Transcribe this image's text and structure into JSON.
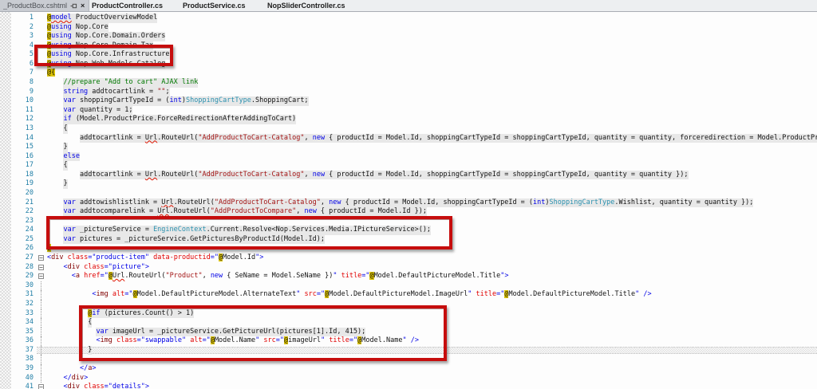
{
  "tab_bar": {
    "active_tab": {
      "label": "_ProductBox.cshtml",
      "pin_icon": "pin-icon",
      "close_icon": "×"
    },
    "tabs": [
      "ProductController.cs",
      "ProductService.cs",
      "NopSliderController.cs"
    ]
  },
  "colors": {
    "annotation_red": "#c60d0d",
    "razor_delimiter_bg": "#dcc404",
    "razor_code_bg": "#e8e8e8",
    "keyword_blue": "#0000e6",
    "type_teal": "#2b91af",
    "string_red": "#a31515",
    "comment_green": "#007800",
    "html_tag_maroon": "#800000",
    "attr_name_red": "#e00000",
    "line_number_teal": "#1f7ea6"
  },
  "annotations": {
    "highlight_boxes": [
      {
        "name": "box-using-infrastructure",
        "lines": "5"
      },
      {
        "name": "box-picture-service",
        "lines": "24-25"
      },
      {
        "name": "box-swappable-image",
        "lines": "33-37"
      }
    ],
    "selection_band_line": 37
  },
  "editor": {
    "lines": [
      {
        "n": 1,
        "rz": 1,
        "segs": [
          [
            "at",
            "@"
          ],
          [
            "k sq",
            "model"
          ],
          [
            "p",
            " ProductOverviewModel"
          ]
        ]
      },
      {
        "n": 2,
        "rz": 1,
        "segs": [
          [
            "at",
            "@"
          ],
          [
            "k",
            "using"
          ],
          [
            "p",
            " Nop.Core"
          ]
        ]
      },
      {
        "n": 3,
        "rz": 1,
        "segs": [
          [
            "at",
            "@"
          ],
          [
            "k",
            "using"
          ],
          [
            "p",
            " Nop.Core.Domain.Orders"
          ]
        ]
      },
      {
        "n": 4,
        "rz": 1,
        "segs": [
          [
            "at",
            "@"
          ],
          [
            "k",
            "using"
          ],
          [
            "p",
            " Nop.Core.Domain.Tax"
          ]
        ]
      },
      {
        "n": 5,
        "rz": 1,
        "segs": [
          [
            "at",
            "@"
          ],
          [
            "k",
            "using"
          ],
          [
            "p",
            " Nop.Core.Infrastructure"
          ]
        ]
      },
      {
        "n": 6,
        "rz": 1,
        "segs": [
          [
            "at",
            "@"
          ],
          [
            "k",
            "using"
          ],
          [
            "p",
            " Nop.Web.Models.Catalog"
          ]
        ]
      },
      {
        "n": 7,
        "segs": [
          [
            "at",
            "@{"
          ]
        ]
      },
      {
        "n": 8,
        "ind": 4,
        "rz": 1,
        "segs": [
          [
            "c",
            "//prepare \"Add to cart\" AJAX link"
          ]
        ]
      },
      {
        "n": 9,
        "ind": 4,
        "rz": 1,
        "segs": [
          [
            "k",
            "string"
          ],
          [
            "p",
            " addtocartlink = "
          ],
          [
            "s",
            "\"\""
          ],
          [
            "p",
            ";"
          ]
        ]
      },
      {
        "n": 10,
        "ind": 4,
        "rz": 1,
        "segs": [
          [
            "k",
            "var"
          ],
          [
            "p",
            " shoppingCartTypeId = ("
          ],
          [
            "k",
            "int"
          ],
          [
            "p",
            ")"
          ],
          [
            "t",
            "ShoppingCartType"
          ],
          [
            "p",
            ".ShoppingCart;"
          ]
        ]
      },
      {
        "n": 11,
        "ind": 4,
        "rz": 1,
        "segs": [
          [
            "k",
            "var"
          ],
          [
            "p",
            " quantity = 1;"
          ]
        ]
      },
      {
        "n": 12,
        "ind": 4,
        "rz": 1,
        "segs": [
          [
            "k",
            "if"
          ],
          [
            "p",
            " (Model.ProductPrice.ForceRedirectionAfterAddingToCart)"
          ]
        ]
      },
      {
        "n": 13,
        "ind": 4,
        "rz": 1,
        "segs": [
          [
            "p",
            "{"
          ]
        ]
      },
      {
        "n": 14,
        "ind": 8,
        "rz": 1,
        "segs": [
          [
            "p",
            "addtocartlink = "
          ],
          [
            "p sq",
            "Url"
          ],
          [
            "p",
            ".RouteUrl("
          ],
          [
            "s",
            "\"AddProductToCart-Catalog\""
          ],
          [
            "p",
            ", "
          ],
          [
            "k",
            "new"
          ],
          [
            "p",
            " { productId = Model.Id, shoppingCartTypeId = shoppingCartTypeId, quantity = quantity, forceredirection = Model.ProductPrice.ForceRedirectionAfterAddingToCart });"
          ]
        ]
      },
      {
        "n": 15,
        "ind": 4,
        "rz": 1,
        "segs": [
          [
            "p",
            "}"
          ]
        ]
      },
      {
        "n": 16,
        "ind": 4,
        "rz": 1,
        "segs": [
          [
            "k",
            "else"
          ]
        ]
      },
      {
        "n": 17,
        "ind": 4,
        "rz": 1,
        "segs": [
          [
            "p",
            "{"
          ]
        ]
      },
      {
        "n": 18,
        "ind": 8,
        "rz": 1,
        "segs": [
          [
            "p",
            "addtocartlink = "
          ],
          [
            "p sq",
            "Url"
          ],
          [
            "p",
            ".RouteUrl("
          ],
          [
            "s",
            "\"AddProductToCart-Catalog\""
          ],
          [
            "p",
            ", "
          ],
          [
            "k",
            "new"
          ],
          [
            "p",
            " { productId = Model.Id, shoppingCartTypeId = shoppingCartTypeId, quantity = quantity });"
          ]
        ]
      },
      {
        "n": 19,
        "ind": 4,
        "rz": 1,
        "segs": [
          [
            "p",
            "}"
          ]
        ]
      },
      {
        "n": 20,
        "rz": 1,
        "segs": []
      },
      {
        "n": 21,
        "ind": 4,
        "rz": 1,
        "segs": [
          [
            "k",
            "var"
          ],
          [
            "p",
            " addtowishlistlink = "
          ],
          [
            "p sq",
            "Url"
          ],
          [
            "p",
            ".RouteUrl("
          ],
          [
            "s",
            "\"AddProductToCart-Catalog\""
          ],
          [
            "p",
            ", "
          ],
          [
            "k",
            "new"
          ],
          [
            "p",
            " { productId = Model.Id, shoppingCartTypeId = ("
          ],
          [
            "k",
            "int"
          ],
          [
            "p",
            ")"
          ],
          [
            "t",
            "ShoppingCartType"
          ],
          [
            "p",
            ".Wishlist, quantity = quantity });"
          ]
        ]
      },
      {
        "n": 22,
        "ind": 4,
        "rz": 1,
        "segs": [
          [
            "k",
            "var"
          ],
          [
            "p",
            " addtocomparelink = "
          ],
          [
            "p sq",
            "Url"
          ],
          [
            "p",
            ".RouteUrl("
          ],
          [
            "s",
            "\"AddProductToCompare\""
          ],
          [
            "p",
            ", "
          ],
          [
            "k",
            "new"
          ],
          [
            "p",
            " { productId = Model.Id });"
          ]
        ]
      },
      {
        "n": 23,
        "rz": 1,
        "segs": []
      },
      {
        "n": 24,
        "ind": 4,
        "rz": 1,
        "segs": [
          [
            "k",
            "var"
          ],
          [
            "p",
            " _pictureService = "
          ],
          [
            "t",
            "EngineContext"
          ],
          [
            "p",
            ".Current.Resolve<Nop.Services.Media.IPictureService>();"
          ]
        ]
      },
      {
        "n": 25,
        "ind": 4,
        "rz": 1,
        "segs": [
          [
            "k",
            "var"
          ],
          [
            "p",
            " pictures = _pictureService.GetPicturesByProductId(Model.Id);"
          ]
        ]
      },
      {
        "n": 26,
        "segs": [
          [
            "at",
            "}"
          ]
        ]
      },
      {
        "n": 27,
        "fold": "box",
        "segs": [
          [
            "b",
            "<"
          ],
          [
            "h",
            "div"
          ],
          [
            "p",
            " "
          ],
          [
            "a",
            "class"
          ],
          [
            "b",
            "=\""
          ],
          [
            "v",
            "product-item"
          ],
          [
            "b",
            "\""
          ],
          [
            "p",
            " "
          ],
          [
            "a",
            "data-productid"
          ],
          [
            "b",
            "=\""
          ],
          [
            "at",
            "@"
          ],
          [
            "p",
            "Model.Id"
          ],
          [
            "b",
            "\">"
          ]
        ]
      },
      {
        "n": 28,
        "ind": 4,
        "fold": "box",
        "segs": [
          [
            "b",
            "<"
          ],
          [
            "h",
            "div"
          ],
          [
            "p",
            " "
          ],
          [
            "a",
            "class"
          ],
          [
            "b",
            "=\""
          ],
          [
            "v",
            "picture"
          ],
          [
            "b",
            "\">"
          ]
        ]
      },
      {
        "n": 29,
        "ind": 6,
        "fold": "box",
        "segs": [
          [
            "b",
            "<"
          ],
          [
            "h",
            "a"
          ],
          [
            "p",
            " "
          ],
          [
            "a",
            "href"
          ],
          [
            "b",
            "=\""
          ],
          [
            "at",
            "@"
          ],
          [
            "p sq",
            "Url"
          ],
          [
            "p",
            ".RouteUrl("
          ],
          [
            "s",
            "\"Product\""
          ],
          [
            "p",
            ", "
          ],
          [
            "k",
            "new"
          ],
          [
            "p",
            " { SeName = Model.SeName })"
          ],
          [
            "b",
            "\""
          ],
          [
            "p",
            " "
          ],
          [
            "a",
            "title"
          ],
          [
            "b",
            "=\""
          ],
          [
            "at",
            "@"
          ],
          [
            "p",
            "Model.DefaultPictureModel.Title"
          ],
          [
            "b",
            "\">"
          ]
        ]
      },
      {
        "n": 30,
        "fold": "bar",
        "segs": []
      },
      {
        "n": 31,
        "ind": 11,
        "fold": "bar",
        "segs": [
          [
            "b",
            "<"
          ],
          [
            "h",
            "img"
          ],
          [
            "p",
            " "
          ],
          [
            "a",
            "alt"
          ],
          [
            "b",
            "=\""
          ],
          [
            "at",
            "@"
          ],
          [
            "p",
            "Model.DefaultPictureModel.AlternateText"
          ],
          [
            "b",
            "\""
          ],
          [
            "p",
            " "
          ],
          [
            "a",
            "src"
          ],
          [
            "b",
            "=\""
          ],
          [
            "at",
            "@"
          ],
          [
            "p",
            "Model.DefaultPictureModel.ImageUrl"
          ],
          [
            "b",
            "\""
          ],
          [
            "p",
            " "
          ],
          [
            "a",
            "title"
          ],
          [
            "b",
            "=\""
          ],
          [
            "at",
            "@"
          ],
          [
            "p",
            "Model.DefaultPictureModel.Title"
          ],
          [
            "b",
            "\""
          ],
          [
            "p",
            " "
          ],
          [
            "b",
            "/>"
          ]
        ]
      },
      {
        "n": 32,
        "fold": "bar",
        "segs": []
      },
      {
        "n": 33,
        "ind": 10,
        "rz": 1,
        "fold": "bar",
        "segs": [
          [
            "at",
            "@"
          ],
          [
            "k",
            "if"
          ],
          [
            "p",
            " (pictures.Count() > 1)"
          ]
        ]
      },
      {
        "n": 34,
        "ind": 10,
        "rz": 1,
        "fold": "bar",
        "segs": [
          [
            "p",
            "{"
          ]
        ]
      },
      {
        "n": 35,
        "ind": 12,
        "rz": 1,
        "fold": "bar",
        "segs": [
          [
            "k",
            "var"
          ],
          [
            "p",
            " imageUrl = _pictureService.GetPictureUrl(pictures[1].Id, 415);"
          ]
        ]
      },
      {
        "n": 36,
        "ind": 12,
        "fold": "bar",
        "segs": [
          [
            "b",
            "<"
          ],
          [
            "h",
            "img"
          ],
          [
            "p",
            " "
          ],
          [
            "a",
            "class"
          ],
          [
            "b",
            "=\""
          ],
          [
            "v",
            "swappable"
          ],
          [
            "b",
            "\""
          ],
          [
            "p",
            " "
          ],
          [
            "a",
            "alt"
          ],
          [
            "b",
            "=\""
          ],
          [
            "at",
            "@"
          ],
          [
            "p",
            "Model.Name"
          ],
          [
            "b",
            "\""
          ],
          [
            "p",
            " "
          ],
          [
            "a",
            "src"
          ],
          [
            "b",
            "=\""
          ],
          [
            "at",
            "@"
          ],
          [
            "p",
            "imageUrl"
          ],
          [
            "b",
            "\""
          ],
          [
            "p",
            " "
          ],
          [
            "a",
            "title"
          ],
          [
            "b",
            "=\""
          ],
          [
            "at",
            "@"
          ],
          [
            "p",
            "Model.Name"
          ],
          [
            "b",
            "\""
          ],
          [
            "p",
            " "
          ],
          [
            "b",
            "/>"
          ]
        ]
      },
      {
        "n": 37,
        "ind": 10,
        "rz": 1,
        "fold": "bar",
        "segs": [
          [
            "p",
            "}"
          ]
        ]
      },
      {
        "n": 38,
        "fold": "bar",
        "segs": []
      },
      {
        "n": 39,
        "ind": 8,
        "fold": "bar",
        "segs": [
          [
            "b",
            "</"
          ],
          [
            "h",
            "a"
          ],
          [
            "b",
            ">"
          ]
        ]
      },
      {
        "n": 40,
        "ind": 4,
        "fold": "bar",
        "segs": [
          [
            "b",
            "</"
          ],
          [
            "h",
            "div"
          ],
          [
            "b",
            ">"
          ]
        ]
      },
      {
        "n": 41,
        "ind": 4,
        "fold": "box",
        "segs": [
          [
            "b",
            "<"
          ],
          [
            "h",
            "div"
          ],
          [
            "p",
            " "
          ],
          [
            "a",
            "class"
          ],
          [
            "b",
            "=\""
          ],
          [
            "v",
            "details"
          ],
          [
            "b",
            "\">"
          ]
        ]
      }
    ]
  }
}
